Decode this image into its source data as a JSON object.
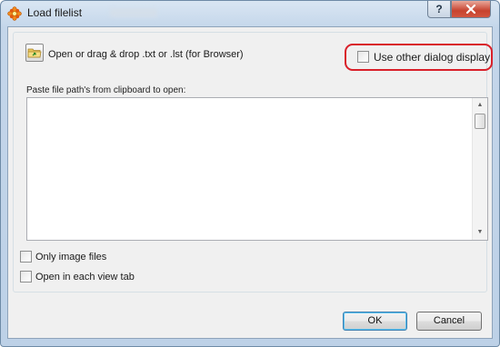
{
  "window": {
    "title": "Load filelist",
    "help_glyph": "?",
    "close_glyph": "✕"
  },
  "dialog": {
    "open_label": "Open or drag & drop .txt or .lst  (for Browser)",
    "use_other_dialog_label": "Use other dialog display",
    "paste_label": "Paste file path's from clipboard to open:",
    "textarea_value": "",
    "only_image_files_label": "Only image files",
    "open_in_each_view_tab_label": "Open in each view tab"
  },
  "checkboxes": {
    "use_other_dialog": false,
    "only_image_files": false,
    "open_in_each_view_tab": false
  },
  "buttons": {
    "ok_label": "OK",
    "cancel_label": "Cancel"
  },
  "scroll": {
    "up_arrow": "▲",
    "down_arrow": "▼"
  },
  "icons": {
    "app": "xnview-flower-icon",
    "open": "open-folder-icon"
  },
  "colors": {
    "highlight_ring": "#d9202a",
    "close_button": "#c7432f",
    "default_button_border": "#3c7fb1"
  }
}
